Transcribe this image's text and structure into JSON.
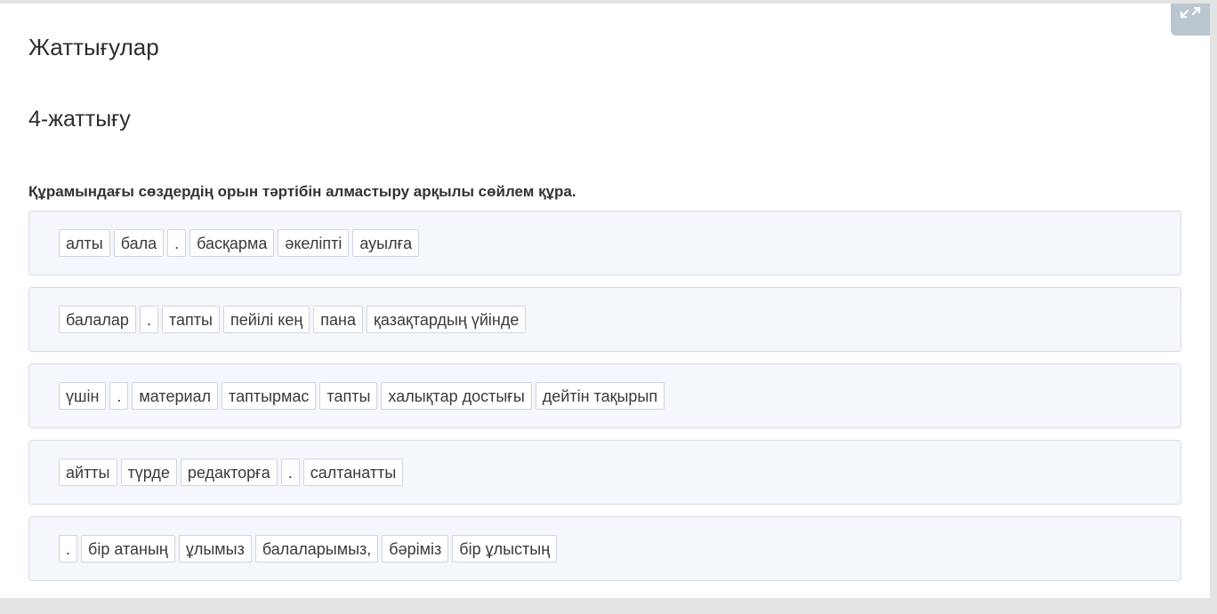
{
  "header": {
    "section_title": "Жаттығулар",
    "fullscreen_icon": "expand-arrows-icon"
  },
  "exercise": {
    "title": "4-жаттығу",
    "instruction": "Құрамындағы сөздердің орын тәртібін алмастыру арқылы сөйлем құра.",
    "rows": [
      {
        "words": [
          "алты",
          "бала",
          ".",
          "басқарма",
          "әкеліпті",
          "ауылға"
        ]
      },
      {
        "words": [
          "балалар",
          ".",
          "тапты",
          "пейілі кең",
          "пана",
          "қазақтардың үйінде"
        ]
      },
      {
        "words": [
          "үшін",
          ".",
          "материал",
          "таптырмас",
          "тапты",
          "халықтар достығы",
          "дейтін тақырып"
        ]
      },
      {
        "words": [
          "айтты",
          "түрде",
          "редакторға",
          ".",
          "салтанатты"
        ]
      },
      {
        "words": [
          ".",
          "бір атаның",
          "ұлымыз",
          "балаларымыз,",
          "бәріміз",
          "бір ұлыстың"
        ]
      }
    ]
  }
}
